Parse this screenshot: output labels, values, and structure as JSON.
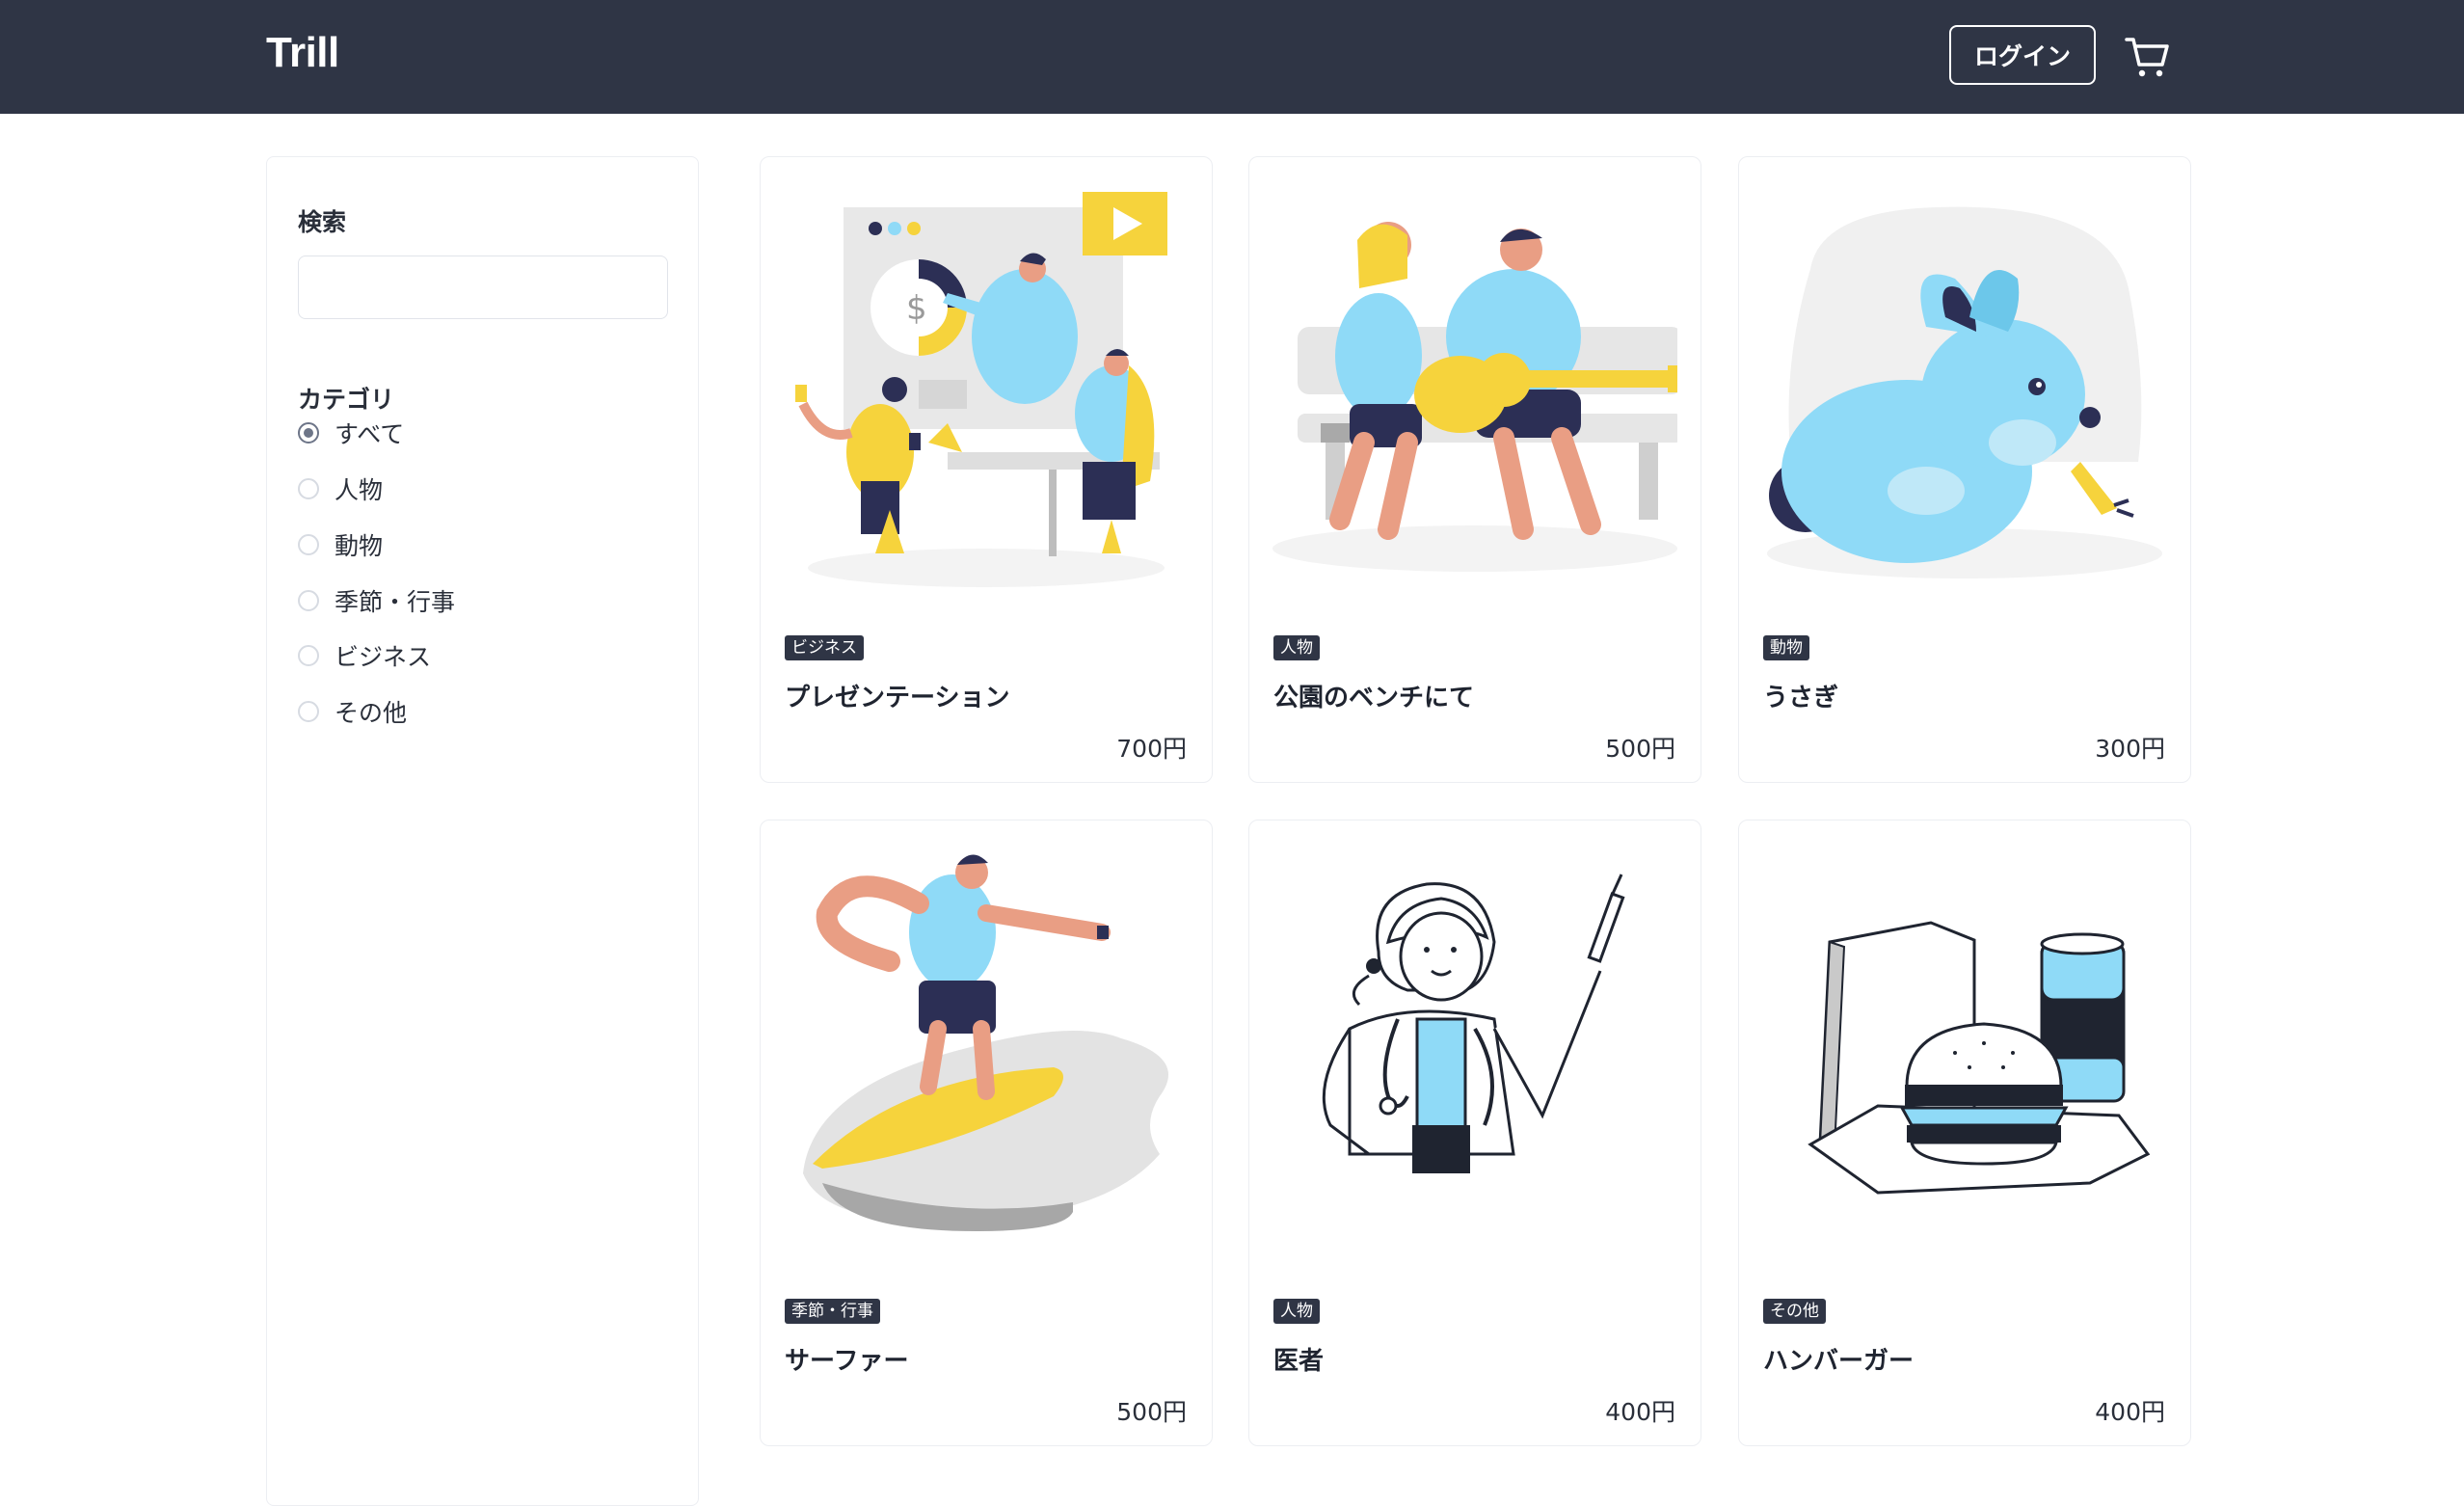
{
  "header": {
    "logo": "Trill",
    "login_label": "ログイン",
    "cart_icon": "cart-icon",
    "background": "#2f3545"
  },
  "sidebar": {
    "search_heading": "検索",
    "search_value": "",
    "category_heading": "カテゴリ",
    "categories": [
      {
        "label": "すべて",
        "checked": true
      },
      {
        "label": "人物",
        "checked": false
      },
      {
        "label": "動物",
        "checked": false
      },
      {
        "label": "季節・行事",
        "checked": false
      },
      {
        "label": "ビジネス",
        "checked": false
      },
      {
        "label": "その他",
        "checked": false
      }
    ]
  },
  "products": [
    {
      "category": "ビジネス",
      "title": "プレゼンテーション",
      "price": "700円",
      "illustration": "presentation-illustration"
    },
    {
      "category": "人物",
      "title": "公園のベンチにて",
      "price": "500円",
      "illustration": "bench-couple-illustration"
    },
    {
      "category": "動物",
      "title": "うさぎ",
      "price": "300円",
      "illustration": "rabbit-illustration"
    },
    {
      "category": "季節・行事",
      "title": "サーファー",
      "price": "500円",
      "illustration": "surfer-illustration"
    },
    {
      "category": "人物",
      "title": "医者",
      "price": "400円",
      "illustration": "doctor-illustration"
    },
    {
      "category": "その他",
      "title": "ハンバーガー",
      "price": "400円",
      "illustration": "hamburger-illustration"
    }
  ]
}
